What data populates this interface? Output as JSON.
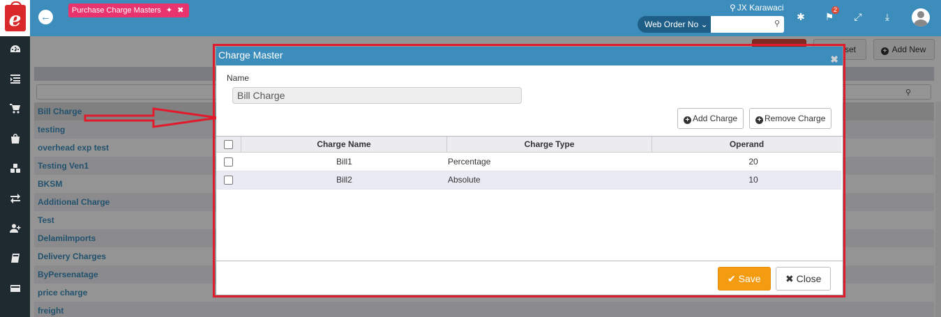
{
  "header": {
    "page_tab": "Purchase Charge Masters",
    "location": "JX Karawaci",
    "search_select": "Web Order No",
    "search_placeholder": "",
    "notification_count": "2"
  },
  "toolbar": {
    "reset_label": "set",
    "add_new_label": "Add New"
  },
  "list": {
    "items": [
      "Bill Charge",
      "testing",
      "overhead exp test",
      "Testing Ven1",
      "BKSM",
      "Additional Charge",
      "Test",
      "DelamiImports",
      "Delivery Charges",
      "ByPersenatage",
      "price charge",
      "freight"
    ]
  },
  "modal": {
    "title": "Charge Master",
    "name_label": "Name",
    "name_value": "Bill Charge",
    "add_charge_label": "Add Charge",
    "remove_charge_label": "Remove Charge",
    "columns": [
      "Charge Name",
      "Charge Type",
      "Operand"
    ],
    "rows": [
      {
        "name": "Bill1",
        "type": "Percentage",
        "operand": "20"
      },
      {
        "name": "Bill2",
        "type": "Absolute",
        "operand": "10"
      }
    ],
    "save_label": "Save",
    "close_label": "Close"
  },
  "colors": {
    "topbar": "#3c8dbc",
    "page_tab": "#e8336d",
    "highlight_border": "#e21b2c",
    "save_button": "#f39c12",
    "sidebar": "#1f2a30"
  }
}
